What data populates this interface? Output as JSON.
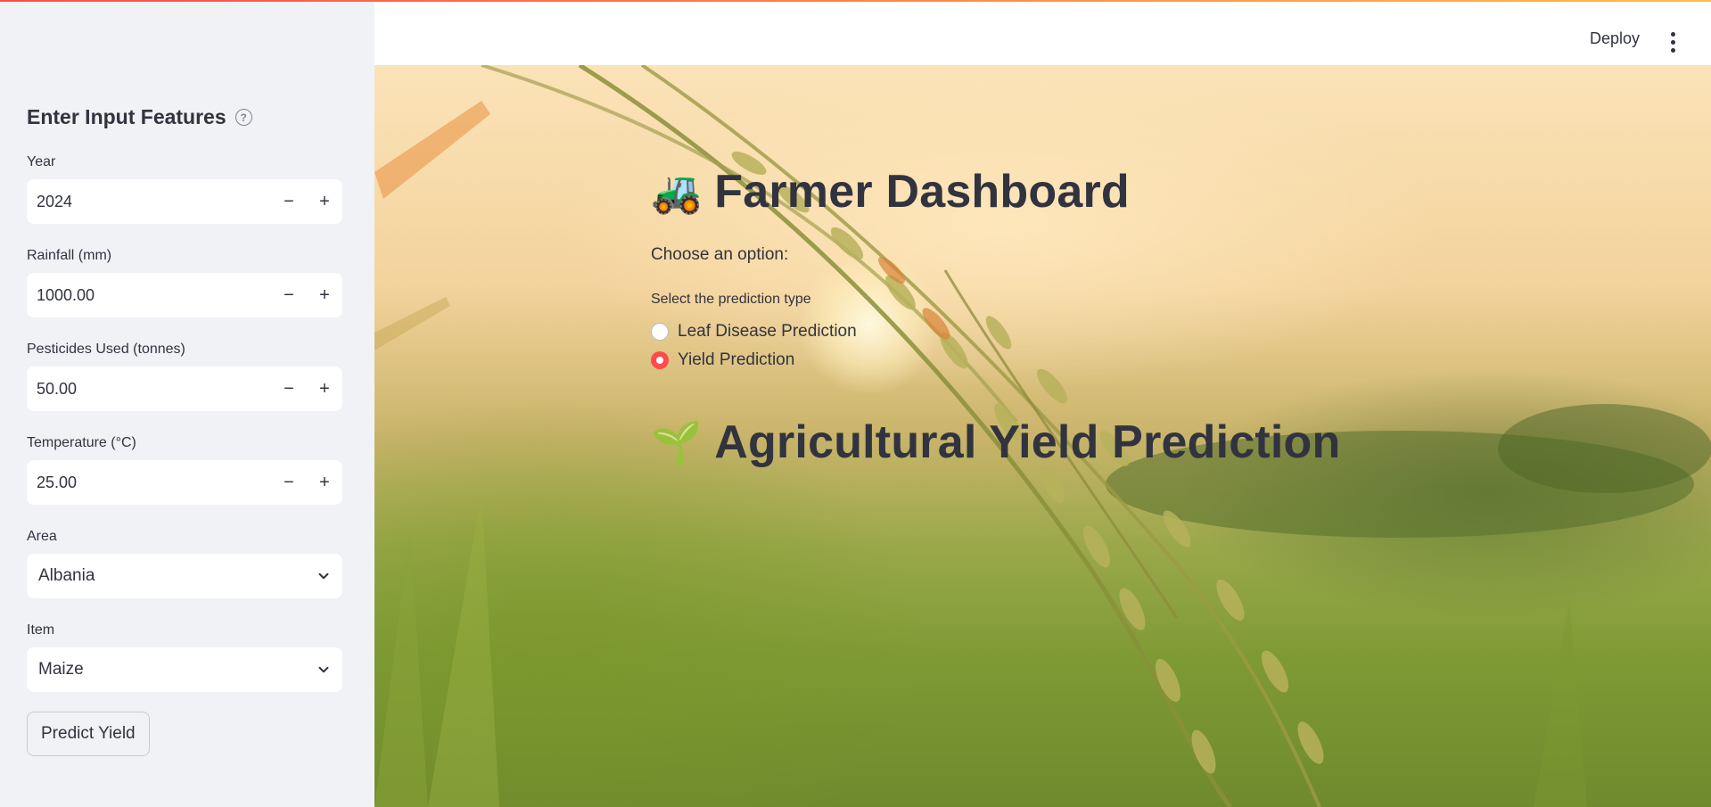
{
  "header": {
    "deploy_label": "Deploy",
    "menu_icon": "more-vertical-icon"
  },
  "sidebar": {
    "heading": "Enter Input Features",
    "help_icon": "help-circle-icon",
    "fields": [
      {
        "label": "Year",
        "value": "2024"
      },
      {
        "label": "Rainfall (mm)",
        "value": "1000.00"
      },
      {
        "label": "Pesticides Used (tonnes)",
        "value": "50.00"
      },
      {
        "label": "Temperature (°C)",
        "value": "25.00"
      }
    ],
    "stepper": {
      "minus": "−",
      "plus": "+"
    },
    "selects": [
      {
        "label": "Area",
        "value": "Albania"
      },
      {
        "label": "Item",
        "value": "Maize"
      }
    ],
    "predict_button": "Predict Yield"
  },
  "main": {
    "title_emoji": "🚜",
    "title": "Farmer Dashboard",
    "choose_text": "Choose an option:",
    "radio_group_label": "Select the prediction type",
    "radio_options": [
      {
        "label": "Leaf Disease Prediction",
        "selected": false
      },
      {
        "label": "Yield Prediction",
        "selected": true
      }
    ],
    "subtitle_emoji": "🌱",
    "subtitle": "Agricultural Yield Prediction"
  },
  "colors": {
    "accent": "#ff4b4b",
    "sidebar_bg": "#f0f2f6",
    "text": "#31333f"
  }
}
